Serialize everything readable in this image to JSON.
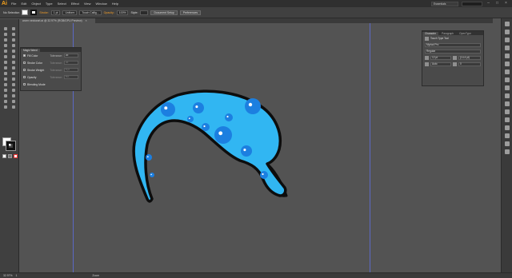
{
  "app": {
    "logo": "Ai",
    "menu": [
      "File",
      "Edit",
      "Object",
      "Type",
      "Select",
      "Effect",
      "View",
      "Window",
      "Help"
    ],
    "workspace": "Essentials"
  },
  "control_bar": {
    "selection": "No Selection",
    "stroke_label": "Stroke:",
    "stroke_weight": "1 pt",
    "uniform": "Uniform",
    "brush": "Touch Callig...",
    "opacity_label": "Opacity:",
    "opacity_value": "100%",
    "style_label": "Style:",
    "document_setup": "Document Setup",
    "preferences": "Preferences"
  },
  "document": {
    "tab_title": "worm vectorart.ai @ 32.97% (RGB/GPU Preview)",
    "close_glyph": "×"
  },
  "magic_wand": {
    "tab": "Magic Wand",
    "rows": [
      {
        "label": "Fill Color",
        "checked": true,
        "tolerance_label": "Tolerance:",
        "tolerance": "20",
        "enabled": true
      },
      {
        "label": "Stroke Color",
        "checked": false,
        "tolerance_label": "Tolerance:",
        "tolerance": "20",
        "enabled": false
      },
      {
        "label": "Stroke Weight",
        "checked": false,
        "tolerance_label": "Tolerance:",
        "tolerance": "5 pt",
        "enabled": false
      },
      {
        "label": "Opacity",
        "checked": false,
        "tolerance_label": "Tolerance:",
        "tolerance": "5%",
        "enabled": false
      },
      {
        "label": "Blending Mode",
        "checked": false,
        "tolerance_label": "",
        "tolerance": "",
        "enabled": false
      }
    ]
  },
  "character_panel": {
    "tabs": [
      "Character",
      "Paragraph",
      "OpenType"
    ],
    "touch_type": "Touch Type Tool",
    "font_family": "Myriad Pro",
    "font_style": "Regular",
    "font_size": "12 pt",
    "leading": "(14.4 pt)",
    "kerning": "Auto",
    "tracking": "0"
  },
  "status": {
    "zoom": "32.97%",
    "page": "1",
    "tool": "Zoom"
  },
  "colors": {
    "worm_body": "#31b6f2",
    "worm_spots": "#1c7fe0",
    "worm_stroke": "#0d0d0d",
    "mouth": "#f01c78",
    "guide": "#5c6bd3",
    "canvas": "#535353"
  }
}
